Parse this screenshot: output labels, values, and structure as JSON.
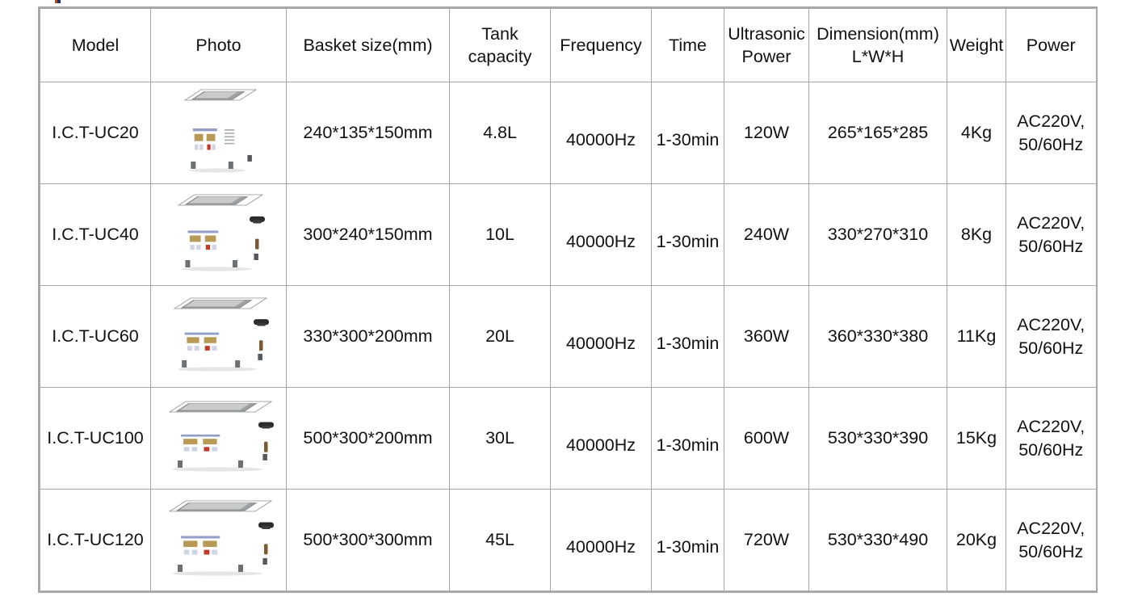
{
  "table": {
    "columns": [
      {
        "key": "model",
        "label": "Model"
      },
      {
        "key": "photo",
        "label": "Photo"
      },
      {
        "key": "basket",
        "label": "Basket size(mm)"
      },
      {
        "key": "tank",
        "label_line1": "Tank",
        "label_line2": "capacity"
      },
      {
        "key": "freq",
        "label": "Frequency"
      },
      {
        "key": "time",
        "label": "Time"
      },
      {
        "key": "uspower",
        "label_line1": "Ultrasonic",
        "label_line2": "Power"
      },
      {
        "key": "dim",
        "label_line1": "Dimension(mm)",
        "label_line2": "L*W*H"
      },
      {
        "key": "weight",
        "label": "Weight"
      },
      {
        "key": "power",
        "label": "Power"
      }
    ],
    "rows": [
      {
        "model": "I.C.T-UC20",
        "photo_alt": "ultrasonic-cleaner-photo",
        "photo_variant": "tall-narrow-no-valve",
        "basket": "240*135*150mm",
        "tank": "4.8L",
        "freq": "40000Hz",
        "time": "1-30min",
        "uspower": "120W",
        "dim": "265*165*285",
        "weight": "4Kg",
        "power_line1": "AC220V,",
        "power_line2": "50/60Hz"
      },
      {
        "model": "I.C.T-UC40",
        "photo_alt": "ultrasonic-cleaner-photo",
        "photo_variant": "medium-with-valve",
        "basket": "300*240*150mm",
        "tank": "10L",
        "freq": "40000Hz",
        "time": "1-30min",
        "uspower": "240W",
        "dim": "330*270*310",
        "weight": "8Kg",
        "power_line1": "AC220V,",
        "power_line2": "50/60Hz"
      },
      {
        "model": "I.C.T-UC60",
        "photo_alt": "ultrasonic-cleaner-photo",
        "photo_variant": "medium-wide-with-valve",
        "basket": "330*300*200mm",
        "tank": "20L",
        "freq": "40000Hz",
        "time": "1-30min",
        "uspower": "360W",
        "dim": "360*330*380",
        "weight": "11Kg",
        "power_line1": "AC220V,",
        "power_line2": "50/60Hz"
      },
      {
        "model": "I.C.T-UC100",
        "photo_alt": "ultrasonic-cleaner-photo",
        "photo_variant": "wide-with-valve",
        "basket": "500*300*200mm",
        "tank": "30L",
        "freq": "40000Hz",
        "time": "1-30min",
        "uspower": "600W",
        "dim": "530*330*390",
        "weight": "15Kg",
        "power_line1": "AC220V,",
        "power_line2": "50/60Hz"
      },
      {
        "model": "I.C.T-UC120",
        "photo_alt": "ultrasonic-cleaner-photo",
        "photo_variant": "wide-tall-with-valve",
        "basket": "500*300*300mm",
        "tank": "45L",
        "freq": "40000Hz",
        "time": "1-30min",
        "uspower": "720W",
        "dim": "530*330*490",
        "weight": "20Kg",
        "power_line1": "AC220V,",
        "power_line2": "50/60Hz"
      }
    ]
  },
  "colors": {
    "border": "#a6a6a6",
    "outer_border": "#a8a8a8",
    "text": "#111111",
    "background": "#ffffff",
    "panel_blue": "#2c3c77",
    "steel_light": "#d9dadb",
    "steel_mid": "#b7b9bb",
    "steel_dark": "#8e9194",
    "display_amber": "#b89a56"
  }
}
